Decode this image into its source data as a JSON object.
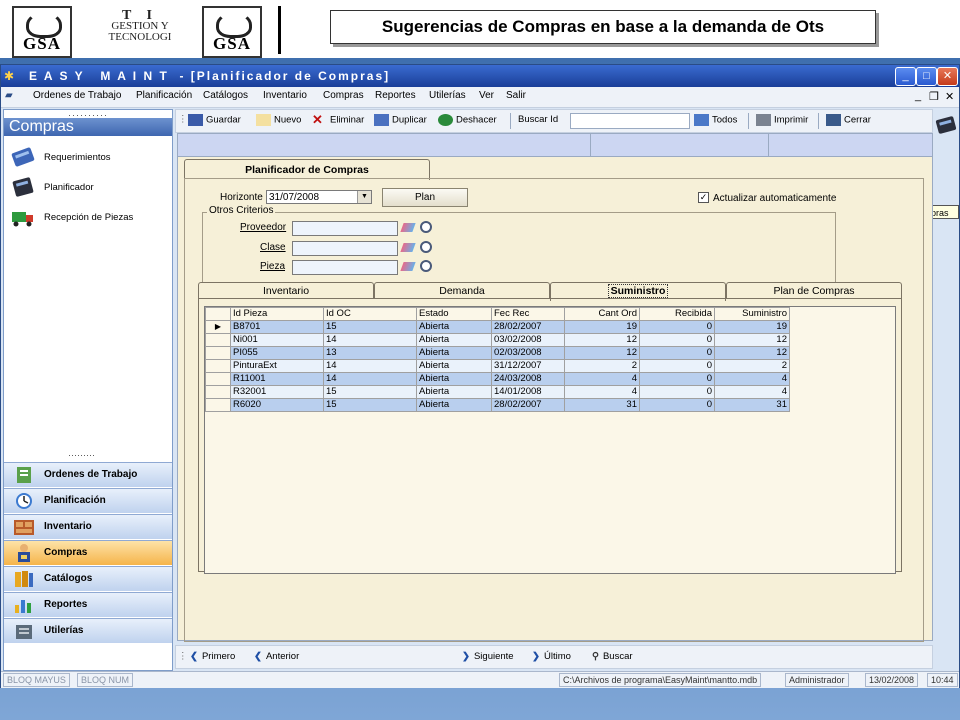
{
  "slide": {
    "heading": "Sugerencias de Compras en base a la demanda de Ots",
    "logo_left": "GSA",
    "logo_right": "GSA",
    "ti_line1": "T I",
    "ti_line2": "GESTION Y",
    "ti_line3": "TECNOLOGI"
  },
  "window": {
    "title": "E A S Y   M A I N T  - [Planificador de Compras]",
    "btn_min": "_",
    "btn_max": "□",
    "btn_close": "✕",
    "mdi_min": "_",
    "mdi_restore": "❐",
    "mdi_close": "✕"
  },
  "menu": [
    "Ordenes de Trabajo",
    "Planificación",
    "Catálogos",
    "Inventario",
    "Compras",
    "Reportes",
    "Utilerías",
    "Ver",
    "Salir"
  ],
  "sidebar": {
    "header": "Compras",
    "items": [
      "Requerimientos",
      "Planificador",
      "Recepción de Piezas"
    ],
    "nav": [
      "Ordenes de Trabajo",
      "Planificación",
      "Inventario",
      "Compras",
      "Catálogos",
      "Reportes",
      "Utilerías"
    ],
    "active_nav": "Compras"
  },
  "toolbar": {
    "guardar": "Guardar",
    "nuevo": "Nuevo",
    "eliminar": "Eliminar",
    "duplicar": "Duplicar",
    "deshacer": "Deshacer",
    "buscar_id": "Buscar Id",
    "todos": "Todos",
    "imprimir": "Imprimir",
    "cerrar": "Cerrar"
  },
  "tooltip": "Planificador de Compras",
  "form": {
    "tab": "Planificador de Compras",
    "horizonte_label": "Horizonte",
    "horizonte_value": "31/07/2008",
    "plan_button": "Plan",
    "auto_update_label": "Actualizar automaticamente",
    "auto_update_checked": "✓",
    "otros_criterios": "Otros Criterios",
    "proveedor": "Proveedor",
    "clase": "Clase",
    "pieza": "Pieza",
    "tabs": [
      "Inventario",
      "Demanda",
      "Suministro",
      "Plan de Compras"
    ],
    "selected_tab": "Suministro"
  },
  "grid": {
    "columns": [
      "Id Pieza",
      "Id OC",
      "Estado",
      "Fec Rec",
      "Cant Ord",
      "Recibida",
      "Suministro"
    ],
    "rows": [
      [
        "B8701",
        "15",
        "Abierta",
        "28/02/2007",
        "19",
        "0",
        "19"
      ],
      [
        "Ni001",
        "14",
        "Abierta",
        "03/02/2008",
        "12",
        "0",
        "12"
      ],
      [
        "PI055",
        "13",
        "Abierta",
        "02/03/2008",
        "12",
        "0",
        "12"
      ],
      [
        "PinturaExt",
        "14",
        "Abierta",
        "31/12/2007",
        "2",
        "0",
        "2"
      ],
      [
        "R11001",
        "14",
        "Abierta",
        "24/03/2008",
        "4",
        "0",
        "4"
      ],
      [
        "R32001",
        "15",
        "Abierta",
        "14/01/2008",
        "4",
        "0",
        "4"
      ],
      [
        "R6020",
        "15",
        "Abierta",
        "28/02/2007",
        "31",
        "0",
        "31"
      ]
    ],
    "current_row_marker": "▶"
  },
  "bottom_nav": {
    "primero": "Primero",
    "anterior": "Anterior",
    "siguiente": "Siguiente",
    "ultimo": "Último",
    "buscar": "Buscar"
  },
  "status": {
    "bloq_mayus": "BLOQ MAYUS",
    "bloq_num": "BLOQ NUM",
    "path": "C:\\Archivos de programa\\EasyMaint\\mantto.mdb",
    "user": "Administrador",
    "date": "13/02/2008",
    "time": "10:44"
  },
  "colors": {
    "accent": "#1a3e98",
    "active_nav": "#f5b44a",
    "row_alt": "#b9cfee"
  }
}
